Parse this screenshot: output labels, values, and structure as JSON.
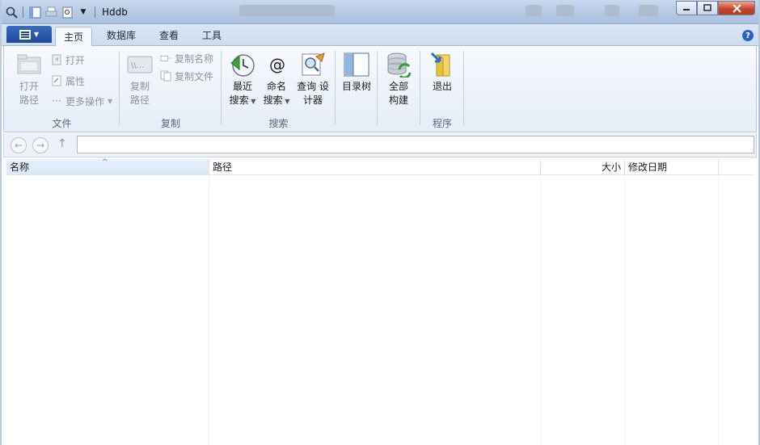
{
  "window": {
    "title": "Hddb"
  },
  "tabs": {
    "home": "主页",
    "database": "数据库",
    "view": "查看",
    "tools": "工具"
  },
  "ribbon": {
    "file_group": {
      "label": "文件",
      "open_path": "打开\n路径",
      "open": "打开",
      "properties": "属性",
      "more_actions": "更多操作"
    },
    "copy_group": {
      "label": "复制",
      "copy_path": "复制\n路径",
      "copy_name": "复制名称",
      "copy_file": "复制文件"
    },
    "search_group": {
      "label": "搜索",
      "recent_search": "最近\n搜索",
      "name_search": "命名\n搜索",
      "query_designer": "查询 设\n计器"
    },
    "dir_tree": "目录树",
    "build_all": "全部\n构建",
    "program_group": {
      "label": "程序",
      "exit": "退出"
    }
  },
  "address": {
    "value": ""
  },
  "list": {
    "columns": {
      "name": "名称",
      "path": "路径",
      "size": "大小",
      "modified": "修改日期"
    },
    "rows": []
  },
  "colors": {
    "accent": "#1e4b9a",
    "ribbon_bg": "#eef2f8",
    "close_button": "#c8452e"
  }
}
